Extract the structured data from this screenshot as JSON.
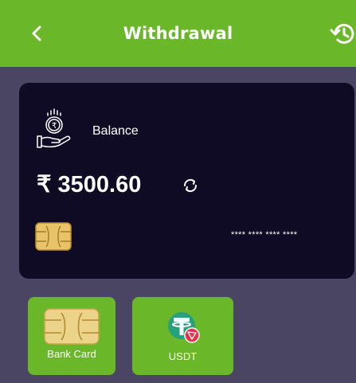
{
  "header": {
    "title": "Withdrawal",
    "back_icon": "chevron-left-icon",
    "history_icon": "history-icon"
  },
  "balance_card": {
    "label": "Balance",
    "amount": "₹ 3500.60",
    "masked_number": "**** **** **** ****",
    "icons": [
      "hand-coin-icon",
      "refresh-icon",
      "sim-chip-icon"
    ]
  },
  "methods": [
    {
      "label": "Bank Card",
      "icon": "sim-chip-icon"
    },
    {
      "label": "USDT",
      "icon": "tether-icon"
    }
  ],
  "colors": {
    "accent": "#6ab82a",
    "page_background": "#4a4562",
    "card_background": "#0f0b25",
    "chip": "#e8c36a",
    "tether": "#26a17b",
    "tron": "#e8324d"
  }
}
